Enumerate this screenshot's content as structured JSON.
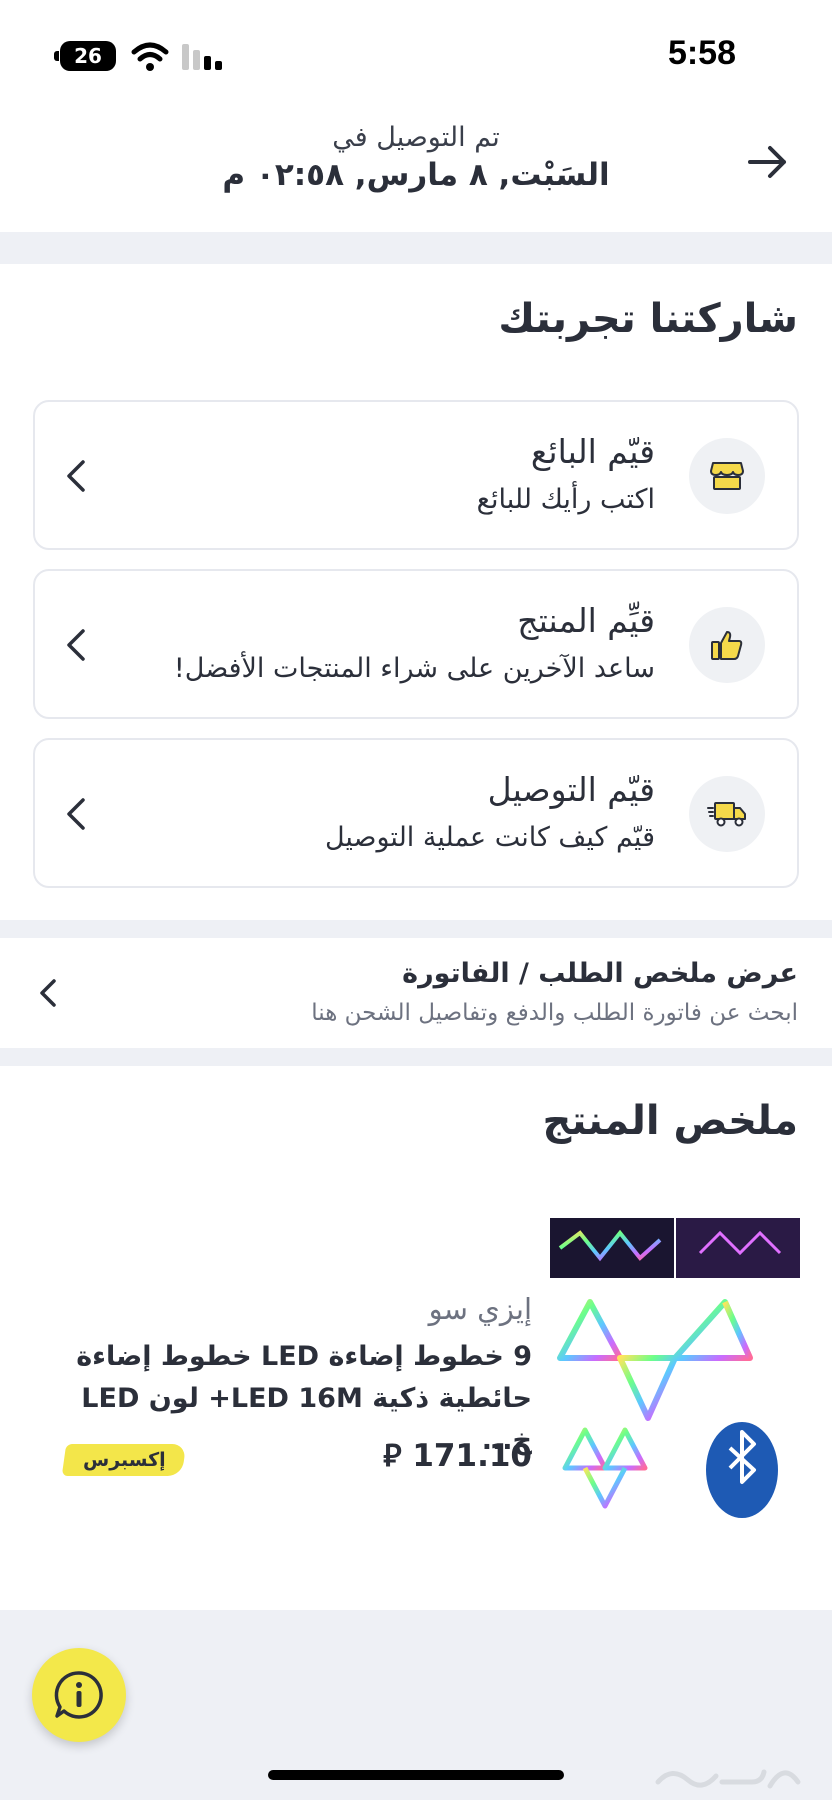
{
  "status_bar": {
    "battery": "26",
    "time": "5:58"
  },
  "delivery": {
    "label": "تم التوصيل في",
    "date": "السَبْت, ٨ مارس, ٠٢:٥٨ م"
  },
  "rate": {
    "title": "شاركتنا تجربتك",
    "items": [
      {
        "title": "قيّم البائع",
        "subtitle": "اكتب رأيك للبائع",
        "icon": "store-icon"
      },
      {
        "title": "قيِّم المنتج",
        "subtitle": "ساعد الآخرين على شراء المنتجات الأفضل!",
        "icon": "thumbs-up-icon"
      },
      {
        "title": "قيّم التوصيل",
        "subtitle": "قيّم كيف كانت عملية التوصيل",
        "icon": "delivery-truck-icon"
      }
    ]
  },
  "invoice": {
    "title": "عرض ملخص الطلب / الفاتورة",
    "subtitle": "ابحث عن فاتورة الطلب والدفع وتفاصيل الشحن هنا"
  },
  "product_summary": {
    "title": "ملخص المنتج",
    "brand": "إيزي سو",
    "name": "9 خطوط إضاءة LED خطوط إضاءة حائطية ذكية LED 16M+ لون LED خ...",
    "price": "171.10",
    "currency_symbol": "⃁",
    "badge": "إكسبرس"
  },
  "colors": {
    "accent_yellow": "#f3e84a",
    "background_gray": "#eef0f5"
  }
}
